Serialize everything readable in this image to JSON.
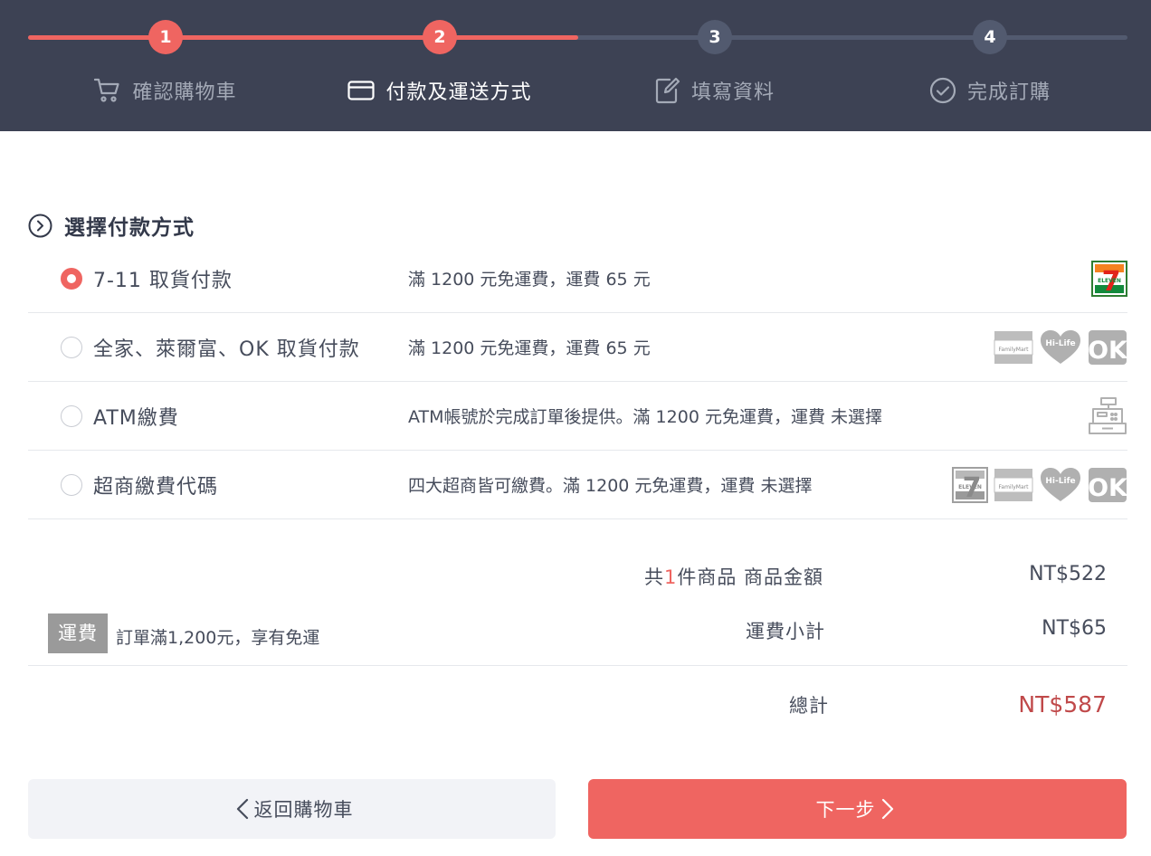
{
  "stepper": {
    "progress_fraction": 0.5,
    "steps": [
      {
        "number": "1",
        "label": "確認購物車",
        "icon": "cart-icon"
      },
      {
        "number": "2",
        "label": "付款及運送方式",
        "icon": "card-icon"
      },
      {
        "number": "3",
        "label": "填寫資料",
        "icon": "edit-icon"
      },
      {
        "number": "4",
        "label": "完成訂購",
        "icon": "check-circle-icon"
      }
    ]
  },
  "payment": {
    "title": "選擇付款方式",
    "options": [
      {
        "name": "7-11 取貨付款",
        "desc": "滿 1200 元免運費，運費 65 元",
        "selected": true,
        "logos": [
          "seven-eleven-logo"
        ]
      },
      {
        "name": "全家、萊爾富、OK 取貨付款",
        "desc": "滿 1200 元免運費，運費 65 元",
        "selected": false,
        "logos": [
          "familymart-logo",
          "hilife-logo",
          "ok-mart-logo"
        ]
      },
      {
        "name": "ATM繳費",
        "desc": "ATM帳號於完成訂單後提供。滿 1200 元免運費，運費 未選擇",
        "selected": false,
        "logos": [
          "cash-register-icon"
        ]
      },
      {
        "name": "超商繳費代碼",
        "desc": "四大超商皆可繳費。滿 1200 元免運費，運費 未選擇",
        "selected": false,
        "logos": [
          "seven-eleven-logo",
          "familymart-logo",
          "hilife-logo",
          "ok-mart-logo"
        ]
      }
    ],
    "logo_text": {
      "seven": "7",
      "eleven": "ELEVEN",
      "familymart": "FamilyMart",
      "hilife": "Hi-Life",
      "ok": "OK"
    }
  },
  "summary": {
    "count_prefix": "共",
    "count": "1",
    "count_suffix": "件商品 商品金額",
    "subtotal": "NT$522",
    "shipping_label": "運費小計",
    "shipping": "NT$65",
    "total_label": "總計",
    "total": "NT$587",
    "shipping_badge": "運費",
    "shipping_note": "訂單滿1,200元，享有免運"
  },
  "buttons": {
    "back": "返回購物車",
    "next": "下一步"
  },
  "colors": {
    "header_bg": "#3d4254",
    "accent": "#ef6561",
    "total": "#c0494a"
  }
}
